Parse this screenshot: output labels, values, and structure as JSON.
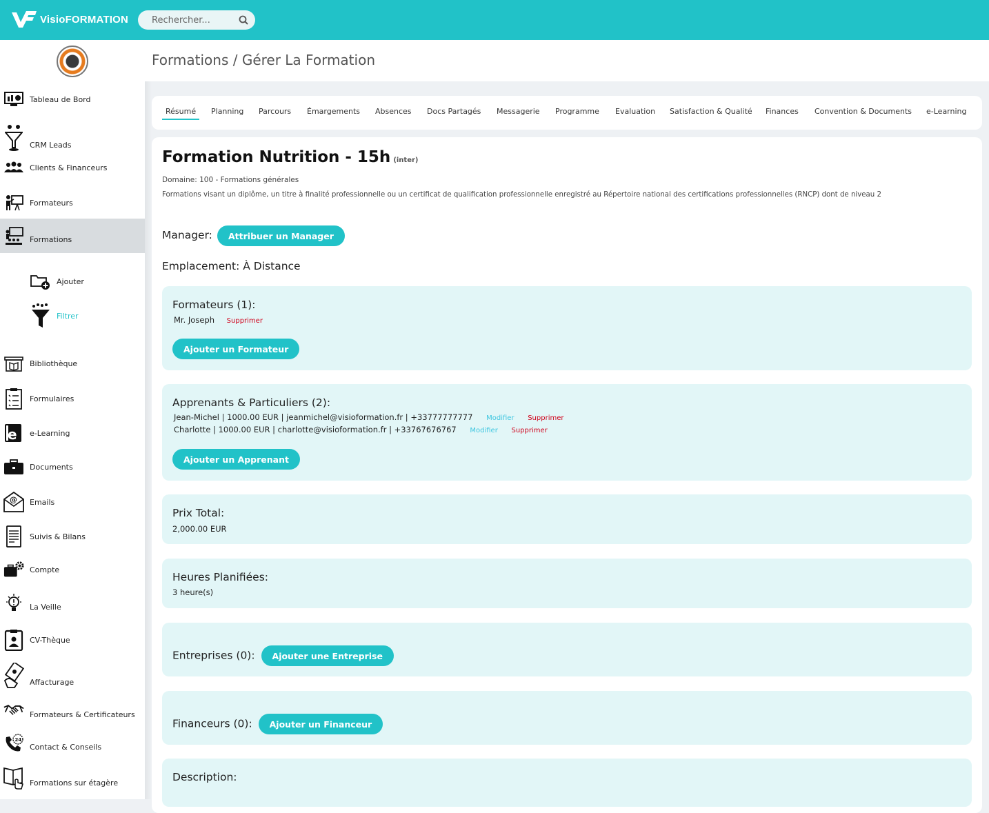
{
  "app": {
    "brand": "VisioFORMATION"
  },
  "search": {
    "placeholder": "Rechercher..."
  },
  "breadcrumb": "Formations / Gérer La Formation",
  "sidebar": {
    "items": [
      {
        "label": "Tableau de Bord",
        "icon": "dashboard-icon"
      },
      {
        "label": "CRM Leads",
        "icon": "funnel-person-icon"
      },
      {
        "label": "Clients & Financeurs",
        "icon": "people-group-icon"
      },
      {
        "label": "Formateurs",
        "icon": "teacher-board-icon"
      },
      {
        "label": "Formations",
        "icon": "classroom-icon",
        "active": true
      },
      {
        "label": "Ajouter",
        "icon": "folder-add-icon",
        "sub": true
      },
      {
        "label": "Filtrer",
        "icon": "filter-funnel-icon",
        "sub": true
      },
      {
        "label": "Bibliothèque",
        "icon": "library-icon"
      },
      {
        "label": "Formulaires",
        "icon": "checklist-icon"
      },
      {
        "label": "e-Learning",
        "icon": "elearning-icon"
      },
      {
        "label": "Documents",
        "icon": "briefcase-icon"
      },
      {
        "label": "Emails",
        "icon": "email-icon"
      },
      {
        "label": "Suivis & Bilans",
        "icon": "report-icon"
      },
      {
        "label": "Compte",
        "icon": "account-gear-icon"
      },
      {
        "label": "La Veille",
        "icon": "lightbulb-icon"
      },
      {
        "label": "CV-Thèque",
        "icon": "cv-clipboard-icon"
      },
      {
        "label": "Affacturage",
        "icon": "money-hand-icon"
      },
      {
        "label": "Formateurs & Certificateurs",
        "icon": "handshake-icon"
      },
      {
        "label": "Contact & Conseils",
        "icon": "phone-24-icon"
      },
      {
        "label": "Formations sur étagère",
        "icon": "book-hand-icon"
      }
    ]
  },
  "tabs": [
    {
      "label": "Résumé",
      "active": true
    },
    {
      "label": "Planning"
    },
    {
      "label": "Parcours"
    },
    {
      "label": "Émargements"
    },
    {
      "label": "Absences"
    },
    {
      "label": "Docs Partagés"
    },
    {
      "label": "Messagerie"
    },
    {
      "label": "Programme"
    },
    {
      "label": "Evaluation"
    },
    {
      "label": "Satisfaction & Qualité"
    },
    {
      "label": "Finances"
    },
    {
      "label": "Convention & Documents"
    },
    {
      "label": "e-Learning"
    }
  ],
  "formation": {
    "title": "Formation Nutrition - 15h",
    "tag": "(inter)",
    "domain": "Domaine: 100 - Formations générales",
    "description": "Formations visant un diplôme, un titre à finalité professionnelle ou un certificat de qualification professionnelle enregistré au Répertoire national des certifications professionnelles (RNCP) dont de niveau 2",
    "manager_label": "Manager:",
    "manager_button": "Attribuer un Manager",
    "location": "Emplacement: À Distance"
  },
  "formateurs": {
    "title": "Formateurs (1):",
    "items": [
      {
        "name": "Mr. Joseph",
        "delete": "Supprimer"
      }
    ],
    "add_button": "Ajouter un Formateur"
  },
  "apprenants": {
    "title": "Apprenants & Particuliers (2):",
    "items": [
      {
        "text": "Jean-Michel | 1000.00 EUR | jeanmichel@visioformation.fr | +33777777777",
        "edit": "Modifier",
        "delete": "Supprimer"
      },
      {
        "text": "Charlotte | 1000.00 EUR | charlotte@visioformation.fr | +33767676767",
        "edit": "Modifier",
        "delete": "Supprimer"
      }
    ],
    "add_button": "Ajouter un Apprenant"
  },
  "prix": {
    "title": "Prix Total:",
    "value": "2,000.00 EUR"
  },
  "heures": {
    "title": "Heures Planifiées:",
    "value": "3 heure(s)"
  },
  "entreprises": {
    "title": "Entreprises (0):",
    "add_button": "Ajouter une Entreprise"
  },
  "financeurs": {
    "title": "Financeurs (0):",
    "add_button": "Ajouter un Financeur"
  },
  "description_card": {
    "title": "Description:"
  },
  "colors": {
    "accent": "#21c2c8",
    "card_bg": "#e2f6f7",
    "danger": "#d0021b",
    "link": "#3ec6e0"
  }
}
